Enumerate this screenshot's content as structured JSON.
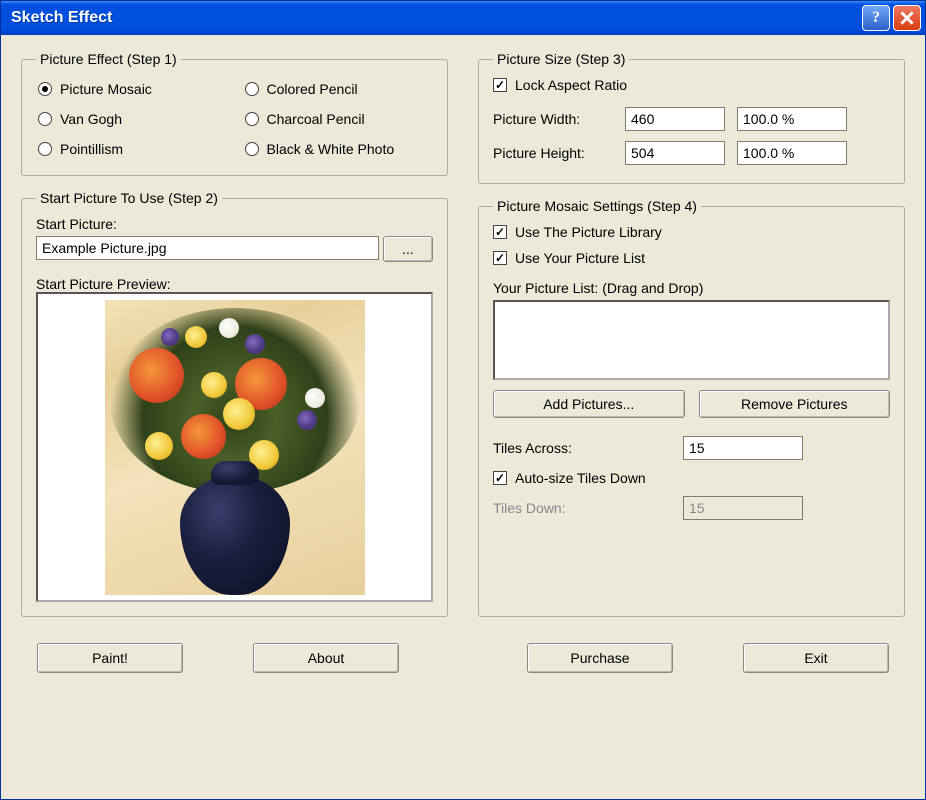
{
  "window": {
    "title": "Sketch Effect"
  },
  "step1": {
    "legend": "Picture Effect (Step 1)",
    "options": {
      "picture_mosaic": "Picture Mosaic",
      "colored_pencil": "Colored Pencil",
      "van_gogh": "Van Gogh",
      "charcoal_pencil": "Charcoal Pencil",
      "pointillism": "Pointillism",
      "bw_photo": "Black & White Photo"
    }
  },
  "step2": {
    "legend": "Start Picture To Use (Step 2)",
    "start_picture_label": "Start Picture:",
    "start_picture_value": "Example Picture.jpg",
    "browse_label": "...",
    "preview_label": "Start Picture Preview:"
  },
  "step3": {
    "legend": "Picture Size (Step 3)",
    "lock_aspect": "Lock Aspect Ratio",
    "width_label": "Picture Width:",
    "width_value": "460",
    "width_pct": "100.0 %",
    "height_label": "Picture Height:",
    "height_value": "504",
    "height_pct": "100.0 %"
  },
  "step4": {
    "legend": "Picture Mosaic Settings (Step 4)",
    "use_library": "Use The Picture Library",
    "use_your_list": "Use Your Picture List",
    "your_list_label": "Your Picture List: (Drag and Drop)",
    "add_pictures": "Add Pictures...",
    "remove_pictures": "Remove Pictures",
    "tiles_across_label": "Tiles Across:",
    "tiles_across_value": "15",
    "auto_size": "Auto-size Tiles Down",
    "tiles_down_label": "Tiles Down:",
    "tiles_down_value": "15"
  },
  "buttons": {
    "paint": "Paint!",
    "about": "About",
    "purchase": "Purchase",
    "exit": "Exit"
  }
}
